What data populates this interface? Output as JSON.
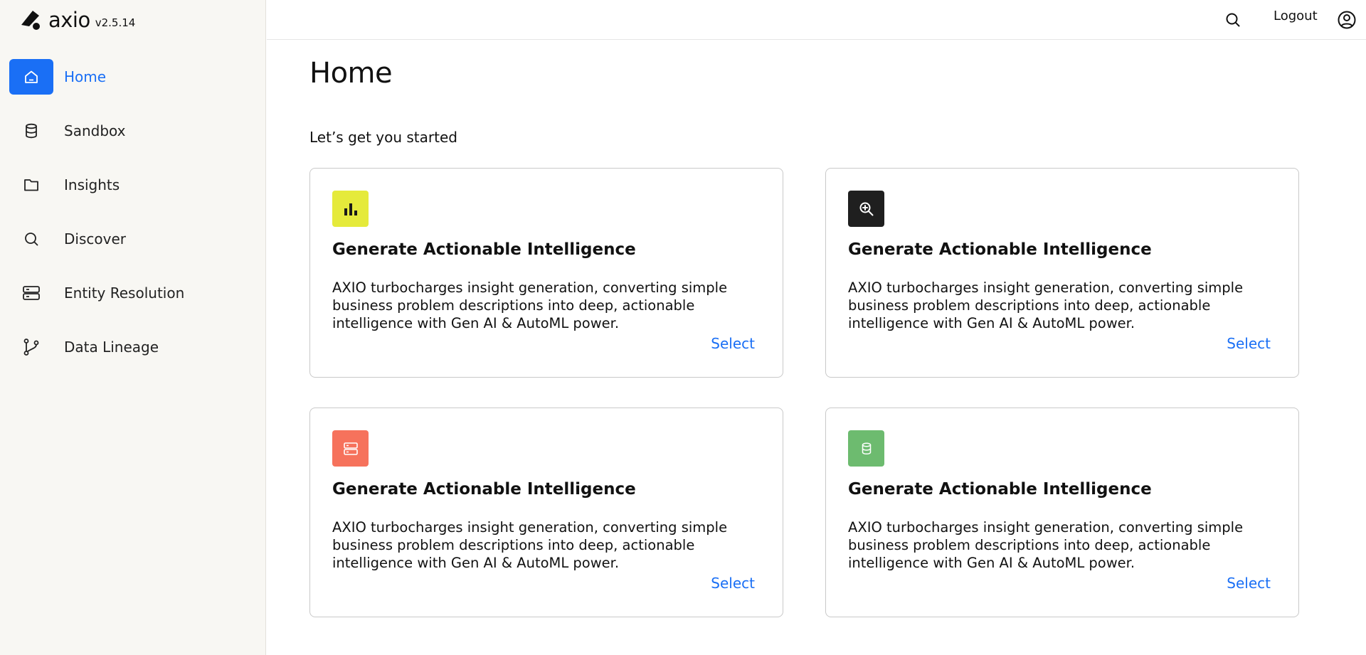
{
  "brand": {
    "name": "axio",
    "version": "v2.5.14"
  },
  "sidebar": {
    "items": [
      {
        "label": "Home",
        "icon": "home-icon",
        "active": true
      },
      {
        "label": "Sandbox",
        "icon": "database-icon",
        "active": false
      },
      {
        "label": "Insights",
        "icon": "folder-icon",
        "active": false
      },
      {
        "label": "Discover",
        "icon": "search-icon",
        "active": false
      },
      {
        "label": "Entity Resolution",
        "icon": "server-icon",
        "active": false
      },
      {
        "label": "Data Lineage",
        "icon": "git-branch-icon",
        "active": false
      }
    ]
  },
  "header": {
    "logout_label": "Logout",
    "search_icon": "search-icon",
    "user_icon": "user-circle-icon"
  },
  "main": {
    "title": "Home",
    "subtitle": "Let’s get you started",
    "cards": [
      {
        "icon": "bar-chart-icon",
        "icon_bg": "#e5ea3b",
        "title": "Generate Actionable Intelligence",
        "description": "AXIO turbocharges insight generation, converting simple business problem descriptions into deep, actionable intelligence with Gen AI & AutoML power.",
        "select_label": "Select"
      },
      {
        "icon": "zoom-in-icon",
        "icon_bg": "#1f1f1f",
        "title": "Generate Actionable Intelligence",
        "description": "AXIO turbocharges insight generation, converting simple business problem descriptions into deep, actionable intelligence with Gen AI & AutoML power.",
        "select_label": "Select"
      },
      {
        "icon": "server-icon",
        "icon_bg": "#f6725c",
        "title": "Generate Actionable Intelligence",
        "description": "AXIO turbocharges insight generation, converting simple business problem descriptions into deep, actionable intelligence with Gen AI & AutoML power.",
        "select_label": "Select"
      },
      {
        "icon": "database-icon",
        "icon_bg": "#6dbb6f",
        "title": "Generate Actionable Intelligence",
        "description": "AXIO turbocharges insight generation, converting simple business problem descriptions into deep, actionable intelligence with Gen AI & AutoML power.",
        "select_label": "Select"
      }
    ]
  },
  "colors": {
    "accent": "#1a6ff5",
    "sidebar_bg": "#f8f7f3"
  }
}
